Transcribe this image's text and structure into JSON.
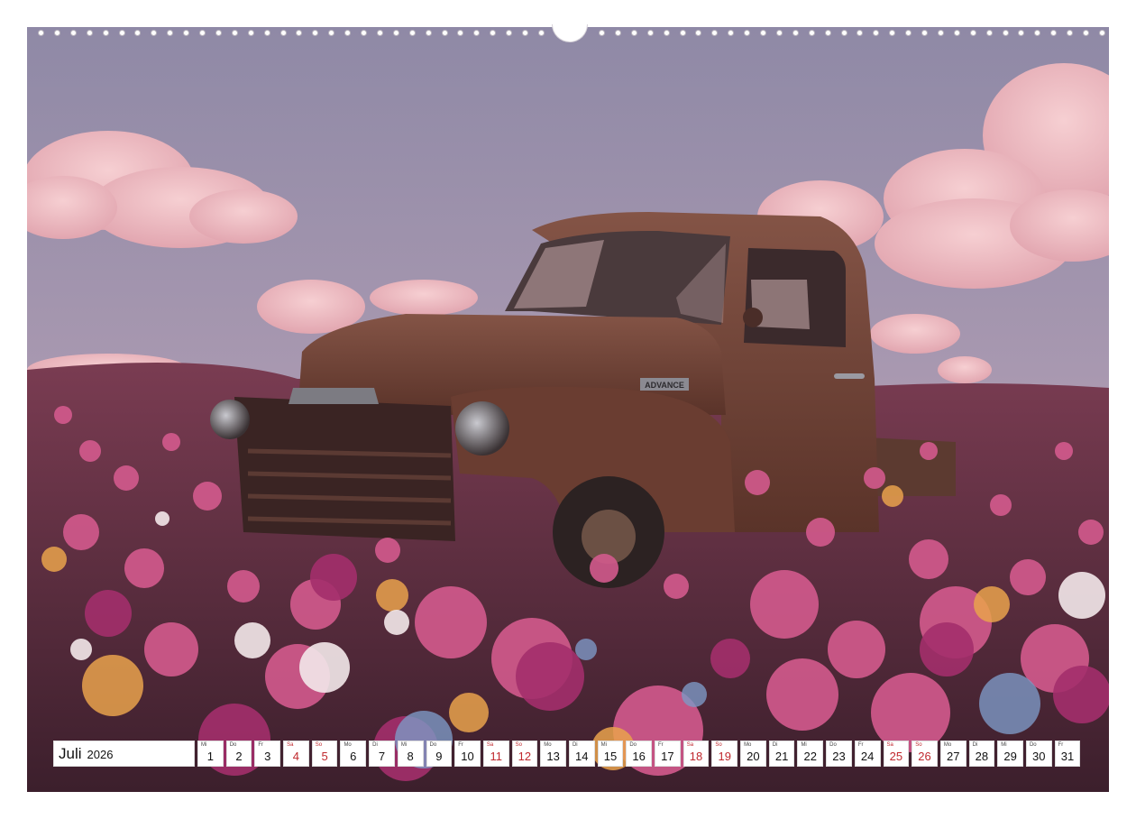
{
  "calendar": {
    "month": "Juli",
    "year": "2026",
    "days": [
      {
        "wd": "Mi",
        "d": "1",
        "weekend": false
      },
      {
        "wd": "Do",
        "d": "2",
        "weekend": false
      },
      {
        "wd": "Fr",
        "d": "3",
        "weekend": false
      },
      {
        "wd": "Sa",
        "d": "4",
        "weekend": true
      },
      {
        "wd": "So",
        "d": "5",
        "weekend": true
      },
      {
        "wd": "Mo",
        "d": "6",
        "weekend": false
      },
      {
        "wd": "Di",
        "d": "7",
        "weekend": false
      },
      {
        "wd": "Mi",
        "d": "8",
        "weekend": false
      },
      {
        "wd": "Do",
        "d": "9",
        "weekend": false
      },
      {
        "wd": "Fr",
        "d": "10",
        "weekend": false
      },
      {
        "wd": "Sa",
        "d": "11",
        "weekend": true
      },
      {
        "wd": "So",
        "d": "12",
        "weekend": true
      },
      {
        "wd": "Mo",
        "d": "13",
        "weekend": false
      },
      {
        "wd": "Di",
        "d": "14",
        "weekend": false
      },
      {
        "wd": "Mi",
        "d": "15",
        "weekend": false
      },
      {
        "wd": "Do",
        "d": "16",
        "weekend": false
      },
      {
        "wd": "Fr",
        "d": "17",
        "weekend": false
      },
      {
        "wd": "Sa",
        "d": "18",
        "weekend": true
      },
      {
        "wd": "So",
        "d": "19",
        "weekend": true
      },
      {
        "wd": "Mo",
        "d": "20",
        "weekend": false
      },
      {
        "wd": "Di",
        "d": "21",
        "weekend": false
      },
      {
        "wd": "Mi",
        "d": "22",
        "weekend": false
      },
      {
        "wd": "Do",
        "d": "23",
        "weekend": false
      },
      {
        "wd": "Fr",
        "d": "24",
        "weekend": false
      },
      {
        "wd": "Sa",
        "d": "25",
        "weekend": true
      },
      {
        "wd": "So",
        "d": "26",
        "weekend": true
      },
      {
        "wd": "Mo",
        "d": "27",
        "weekend": false
      },
      {
        "wd": "Di",
        "d": "28",
        "weekend": false
      },
      {
        "wd": "Mi",
        "d": "29",
        "weekend": false
      },
      {
        "wd": "Do",
        "d": "30",
        "weekend": false
      },
      {
        "wd": "Fr",
        "d": "31",
        "weekend": false
      }
    ]
  },
  "photo": {
    "badge_text": "ADVANCE"
  },
  "colors": {
    "weekend": "#c0282d",
    "sky": "#9a8aa8",
    "rust": "#6e3f32"
  }
}
